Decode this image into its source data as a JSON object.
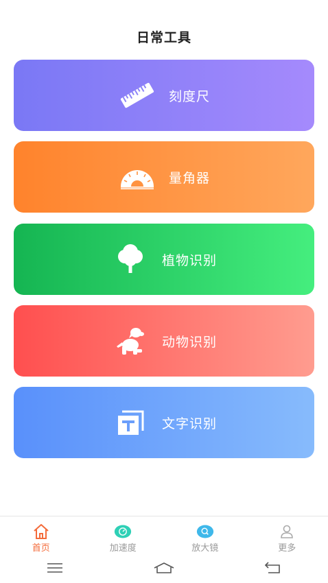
{
  "header": {
    "title": "日常工具"
  },
  "tools": [
    {
      "label": "刻度尺",
      "icon": "ruler-icon"
    },
    {
      "label": "量角器",
      "icon": "protractor-icon"
    },
    {
      "label": "植物识别",
      "icon": "tree-icon"
    },
    {
      "label": "动物识别",
      "icon": "dog-icon"
    },
    {
      "label": "文字识别",
      "icon": "text-icon"
    }
  ],
  "tabs": [
    {
      "label": "首页",
      "icon": "home-icon",
      "active": true
    },
    {
      "label": "加速度",
      "icon": "speed-icon"
    },
    {
      "label": "放大镜",
      "icon": "magnifier-icon"
    },
    {
      "label": "更多",
      "icon": "user-icon"
    }
  ],
  "colors": {
    "accent": "#f46b3a",
    "teal": "#2fd0b6",
    "blue": "#3fb8ea"
  }
}
